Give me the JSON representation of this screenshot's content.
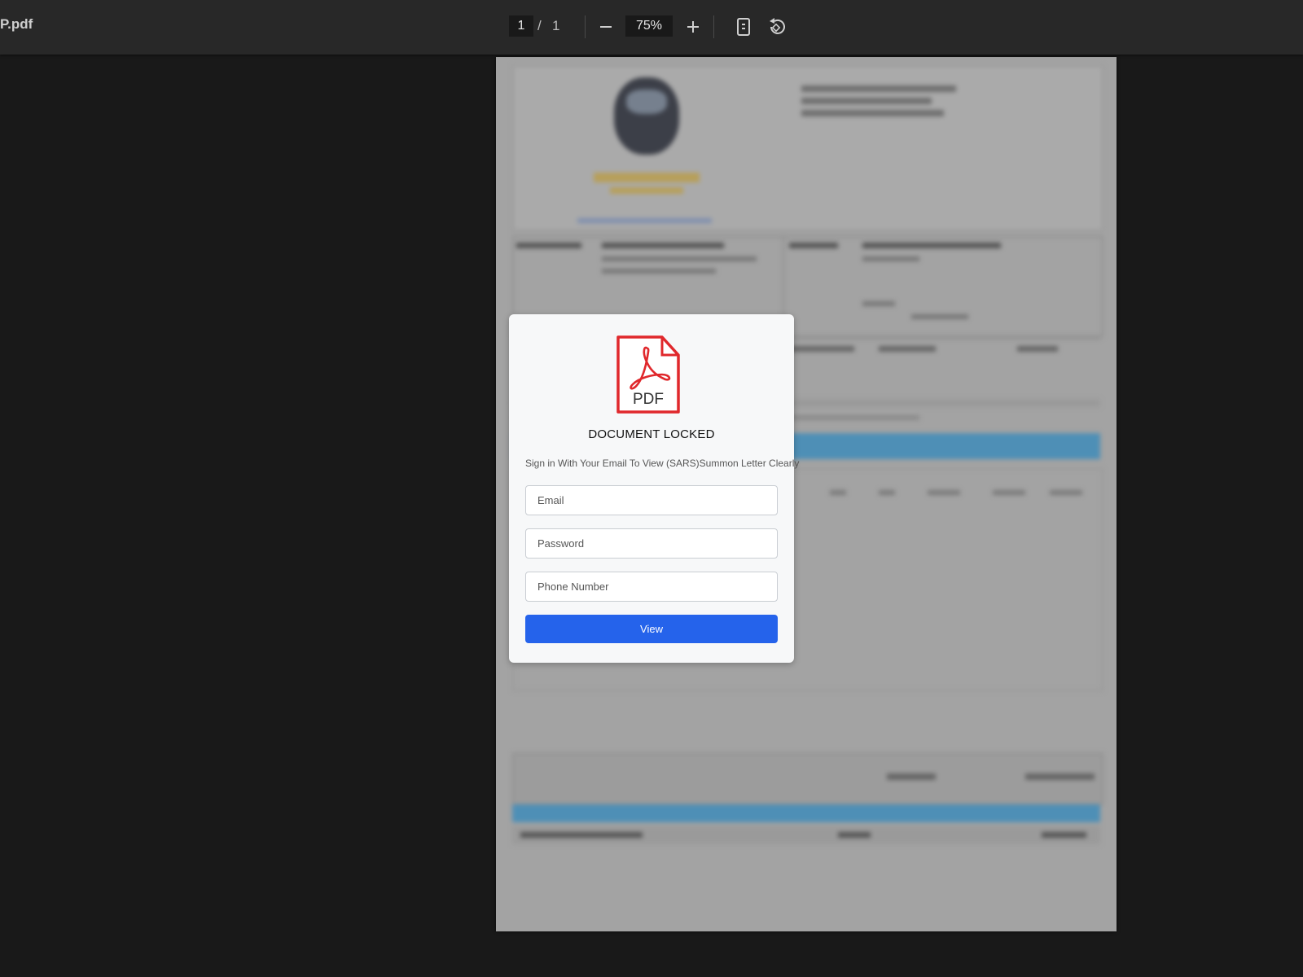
{
  "viewer": {
    "file_name": "P.pdf",
    "page_current": "1",
    "page_separator": "/",
    "page_total": "1",
    "zoom": "75%",
    "icons": {
      "zoom_out": "minus-icon",
      "zoom_in": "plus-icon",
      "fit_page": "fit-page-icon",
      "rotate": "rotate-icon"
    }
  },
  "login": {
    "logo_text": "PDF",
    "title": "DOCUMENT LOCKED",
    "subtitle": "Sign in With Your Email To View (SARS)Summon Letter Clearly",
    "email_placeholder": "Email",
    "password_placeholder": "Password",
    "phone_placeholder": "Phone Number",
    "submit_label": "View"
  },
  "colors": {
    "background": "#191919",
    "toolbar": "#282828",
    "primary_button": "#2563eb",
    "pdf_red": "#e0282c"
  }
}
